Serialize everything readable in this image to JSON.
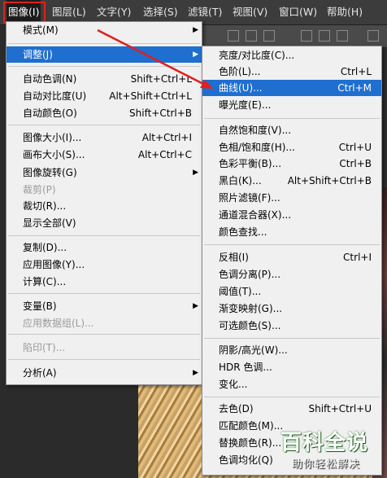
{
  "menubar": {
    "items": [
      "图像(I)",
      "图层(L)",
      "文字(Y)",
      "选择(S)",
      "滤镜(T)",
      "视图(V)",
      "窗口(W)",
      "帮助(H)"
    ]
  },
  "image_menu": {
    "items": [
      {
        "label": "模式(M)",
        "shortcut": "",
        "submenu": true
      },
      {
        "label": "调整(J)",
        "shortcut": "",
        "submenu": true,
        "selected": true
      },
      {
        "label": "自动色调(N)",
        "shortcut": "Shift+Ctrl+L"
      },
      {
        "label": "自动对比度(U)",
        "shortcut": "Alt+Shift+Ctrl+L"
      },
      {
        "label": "自动颜色(O)",
        "shortcut": "Shift+Ctrl+B"
      },
      {
        "label": "图像大小(I)...",
        "shortcut": "Alt+Ctrl+I"
      },
      {
        "label": "画布大小(S)...",
        "shortcut": "Alt+Ctrl+C"
      },
      {
        "label": "图像旋转(G)",
        "shortcut": "",
        "submenu": true
      },
      {
        "label": "裁剪(P)",
        "shortcut": "",
        "disabled": true
      },
      {
        "label": "裁切(R)...",
        "shortcut": ""
      },
      {
        "label": "显示全部(V)",
        "shortcut": ""
      },
      {
        "label": "复制(D)...",
        "shortcut": ""
      },
      {
        "label": "应用图像(Y)...",
        "shortcut": ""
      },
      {
        "label": "计算(C)...",
        "shortcut": ""
      },
      {
        "label": "变量(B)",
        "shortcut": "",
        "submenu": true
      },
      {
        "label": "应用数据组(L)...",
        "shortcut": "",
        "disabled": true
      },
      {
        "label": "陷印(T)...",
        "shortcut": "",
        "disabled": true
      },
      {
        "label": "分析(A)",
        "shortcut": "",
        "submenu": true
      }
    ]
  },
  "adjust_menu": {
    "items": [
      {
        "label": "亮度/对比度(C)...",
        "shortcut": ""
      },
      {
        "label": "色阶(L)...",
        "shortcut": "Ctrl+L"
      },
      {
        "label": "曲线(U)...",
        "shortcut": "Ctrl+M",
        "selected": true
      },
      {
        "label": "曝光度(E)...",
        "shortcut": ""
      },
      {
        "label": "自然饱和度(V)...",
        "shortcut": ""
      },
      {
        "label": "色相/饱和度(H)...",
        "shortcut": "Ctrl+U"
      },
      {
        "label": "色彩平衡(B)...",
        "shortcut": "Ctrl+B"
      },
      {
        "label": "黑白(K)...",
        "shortcut": "Alt+Shift+Ctrl+B"
      },
      {
        "label": "照片滤镜(F)...",
        "shortcut": ""
      },
      {
        "label": "通道混合器(X)...",
        "shortcut": ""
      },
      {
        "label": "颜色查找...",
        "shortcut": ""
      },
      {
        "label": "反相(I)",
        "shortcut": "Ctrl+I"
      },
      {
        "label": "色调分离(P)...",
        "shortcut": ""
      },
      {
        "label": "阈值(T)...",
        "shortcut": ""
      },
      {
        "label": "渐变映射(G)...",
        "shortcut": ""
      },
      {
        "label": "可选颜色(S)...",
        "shortcut": ""
      },
      {
        "label": "阴影/高光(W)...",
        "shortcut": ""
      },
      {
        "label": "HDR 色调...",
        "shortcut": ""
      },
      {
        "label": "变化...",
        "shortcut": ""
      },
      {
        "label": "去色(D)",
        "shortcut": "Shift+Ctrl+U"
      },
      {
        "label": "匹配颜色(M)...",
        "shortcut": ""
      },
      {
        "label": "替换颜色(R)...",
        "shortcut": ""
      },
      {
        "label": "色调均化(Q)",
        "shortcut": ""
      }
    ]
  },
  "watermark": {
    "logo": "百科全说",
    "sub": "助你轻松解决"
  },
  "colors": {
    "selection": "#1e6fd0",
    "highlight_box": "#e02020",
    "arrow": "#e02020"
  }
}
